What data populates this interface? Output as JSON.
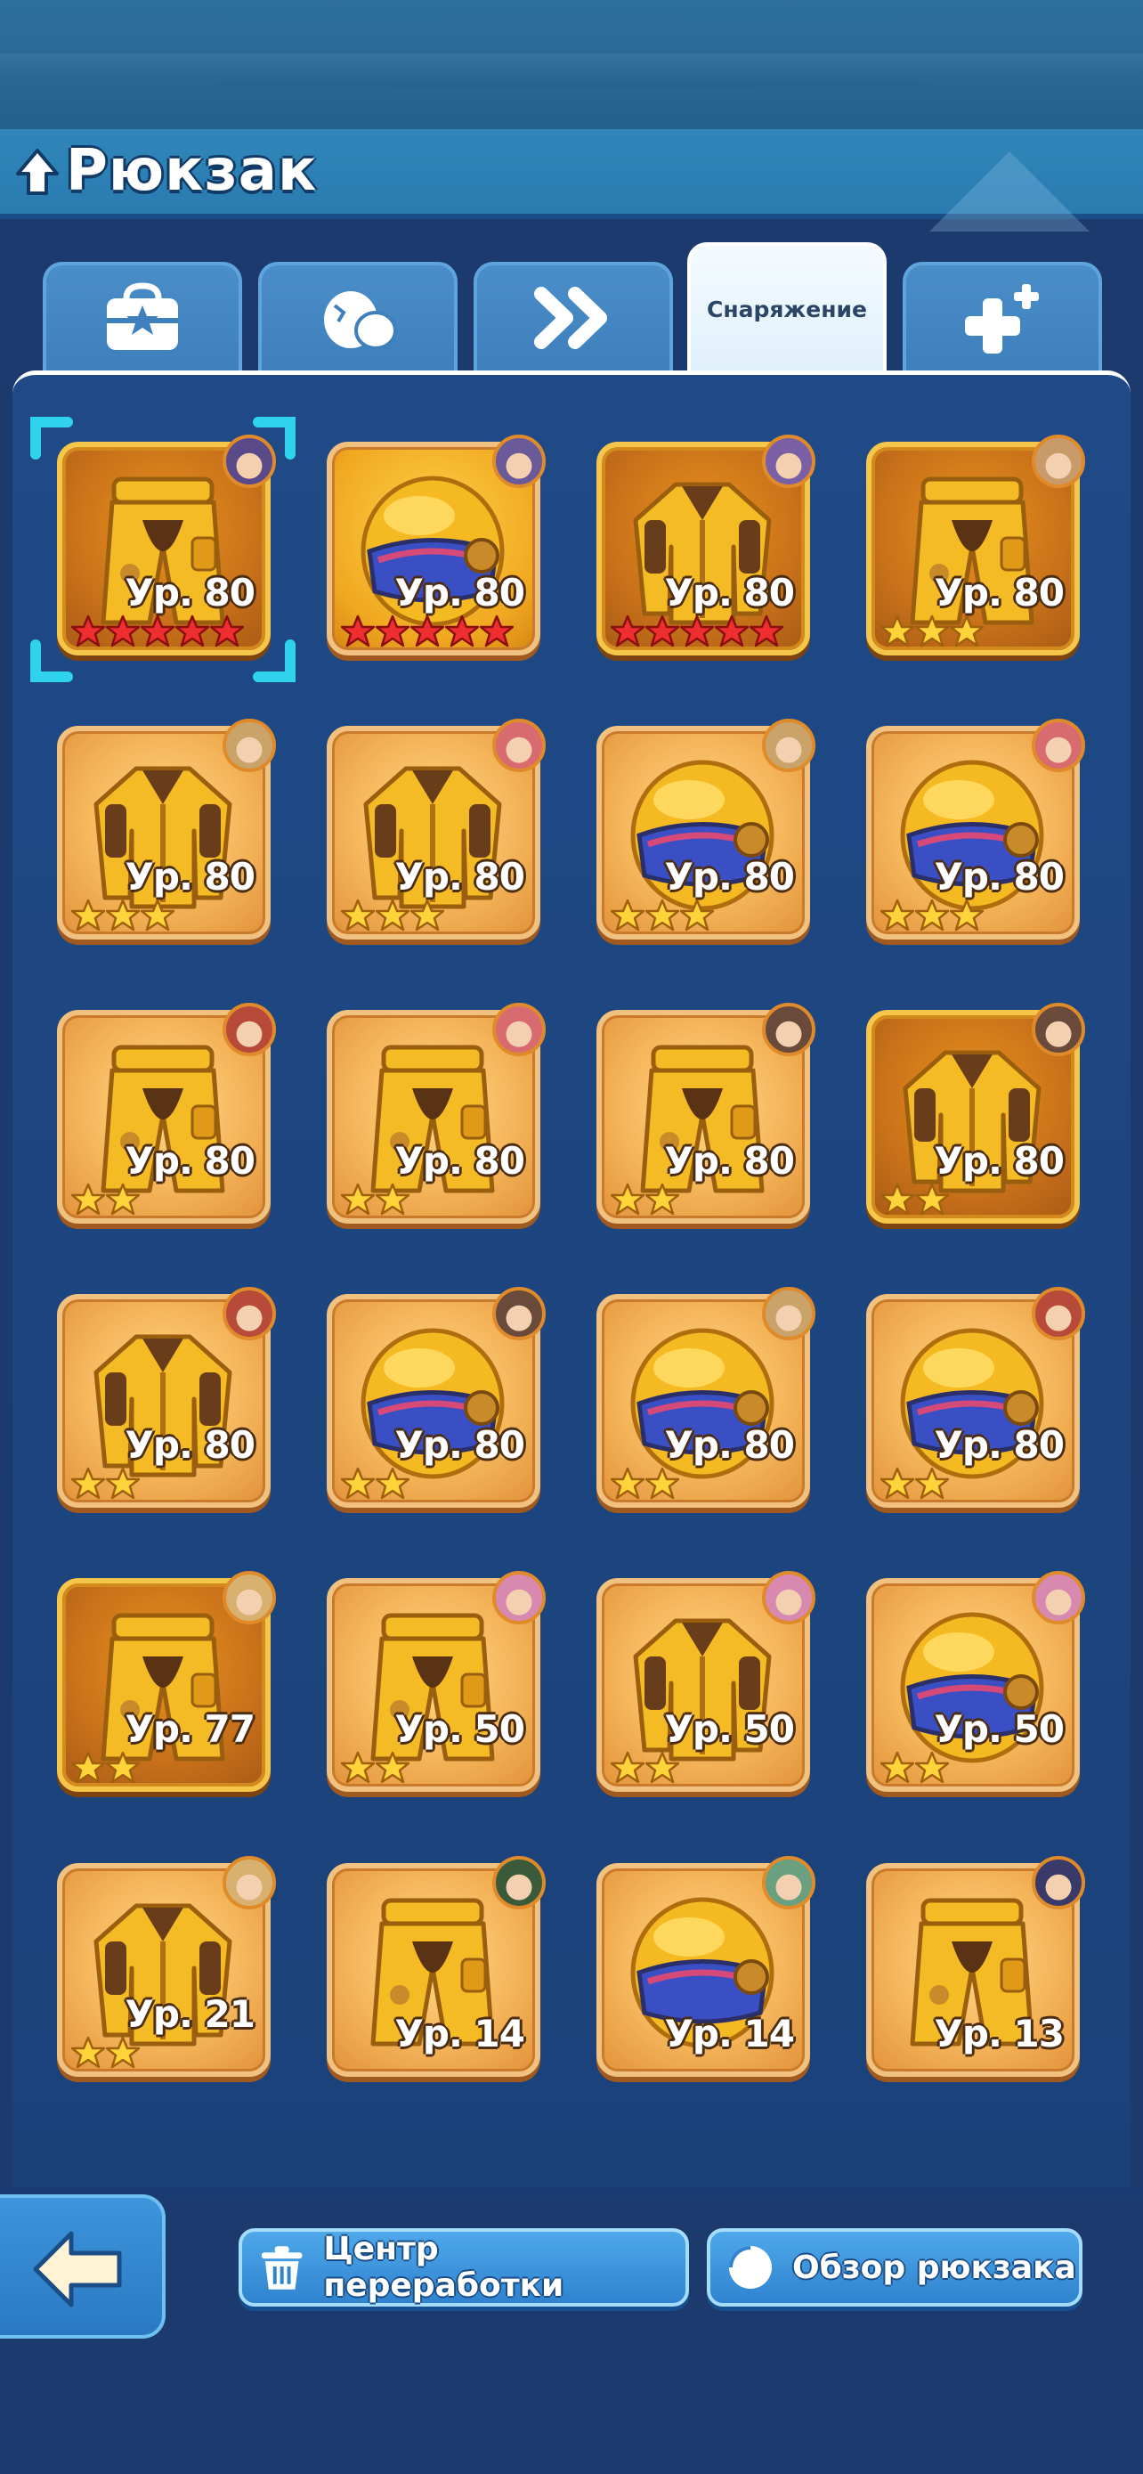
{
  "header": {
    "title": "Рюкзак"
  },
  "tabs": [
    {
      "icon": "bag-star-icon",
      "label": ""
    },
    {
      "icon": "egg-icon",
      "label": ""
    },
    {
      "icon": "double-chevron-icon",
      "label": ""
    },
    {
      "icon": "",
      "label": "Снаряжение",
      "active": true
    },
    {
      "icon": "plus-sparkle-icon",
      "label": ""
    }
  ],
  "items": [
    {
      "type": "pants",
      "level": "Ур. 80",
      "stars": 5,
      "star_color": "red",
      "frame": "gold",
      "selected": true
    },
    {
      "type": "helmet",
      "level": "Ур. 80",
      "stars": 5,
      "star_color": "red",
      "frame": "bright"
    },
    {
      "type": "jacket",
      "level": "Ур. 80",
      "stars": 5,
      "star_color": "red",
      "frame": "gold"
    },
    {
      "type": "pants",
      "level": "Ур. 80",
      "stars": 3,
      "star_color": "gold",
      "frame": "gold"
    },
    {
      "type": "jacket",
      "level": "Ур. 80",
      "stars": 3,
      "star_color": "gold",
      "frame": "light"
    },
    {
      "type": "jacket",
      "level": "Ур. 80",
      "stars": 3,
      "star_color": "gold",
      "frame": "light"
    },
    {
      "type": "helmet",
      "level": "Ур. 80",
      "stars": 3,
      "star_color": "gold",
      "frame": "light"
    },
    {
      "type": "helmet",
      "level": "Ур. 80",
      "stars": 3,
      "star_color": "gold",
      "frame": "light"
    },
    {
      "type": "pants",
      "level": "Ур. 80",
      "stars": 2,
      "star_color": "gold",
      "frame": "light"
    },
    {
      "type": "pants",
      "level": "Ур. 80",
      "stars": 2,
      "star_color": "gold",
      "frame": "light"
    },
    {
      "type": "pants",
      "level": "Ур. 80",
      "stars": 2,
      "star_color": "gold",
      "frame": "light"
    },
    {
      "type": "jacket",
      "level": "Ур. 80",
      "stars": 2,
      "star_color": "gold",
      "frame": "gold"
    },
    {
      "type": "jacket",
      "level": "Ур. 80",
      "stars": 2,
      "star_color": "gold",
      "frame": "light"
    },
    {
      "type": "helmet",
      "level": "Ур. 80",
      "stars": 2,
      "star_color": "gold",
      "frame": "light"
    },
    {
      "type": "helmet",
      "level": "Ур. 80",
      "stars": 2,
      "star_color": "gold",
      "frame": "light"
    },
    {
      "type": "helmet",
      "level": "Ур. 80",
      "stars": 2,
      "star_color": "gold",
      "frame": "light"
    },
    {
      "type": "pants",
      "level": "Ур. 77",
      "stars": 2,
      "star_color": "gold",
      "frame": "gold"
    },
    {
      "type": "pants",
      "level": "Ур. 50",
      "stars": 2,
      "star_color": "gold",
      "frame": "light"
    },
    {
      "type": "jacket",
      "level": "Ур. 50",
      "stars": 2,
      "star_color": "gold",
      "frame": "light"
    },
    {
      "type": "helmet",
      "level": "Ур. 50",
      "stars": 2,
      "star_color": "gold",
      "frame": "light"
    },
    {
      "type": "jacket",
      "level": "Ур. 21",
      "stars": 2,
      "star_color": "gold",
      "frame": "light"
    },
    {
      "type": "pants",
      "level": "Ур. 14",
      "stars": 0,
      "star_color": "gold",
      "frame": "light"
    },
    {
      "type": "helmet",
      "level": "Ур. 14",
      "stars": 0,
      "star_color": "gold",
      "frame": "light"
    },
    {
      "type": "pants",
      "level": "Ур. 13",
      "stars": 0,
      "star_color": "gold",
      "frame": "light"
    }
  ],
  "hero_colors": [
    "#5b4a8a",
    "#6a5a9a",
    "#7a5fa5",
    "#c99a6a",
    "#c9a36a",
    "#d86b70",
    "#c9a36a",
    "#d86b70",
    "#b84a3a",
    "#d86b70",
    "#6a4a3a",
    "#6a4a3a",
    "#b84a3a",
    "#6a4a3a",
    "#c9a36a",
    "#b84a3a",
    "#d8b070",
    "#d889b0",
    "#d889b0",
    "#d889b0",
    "#d8b070",
    "#3a5a3a",
    "#6aa080",
    "#3a3a6a"
  ],
  "buttons": {
    "recycle": {
      "label": "Центр переработки",
      "icon": "trash-icon"
    },
    "overview": {
      "label": "Обзор рюкзака",
      "icon": "pie-chart-icon"
    },
    "back": {
      "icon": "back-arrow-icon"
    }
  }
}
